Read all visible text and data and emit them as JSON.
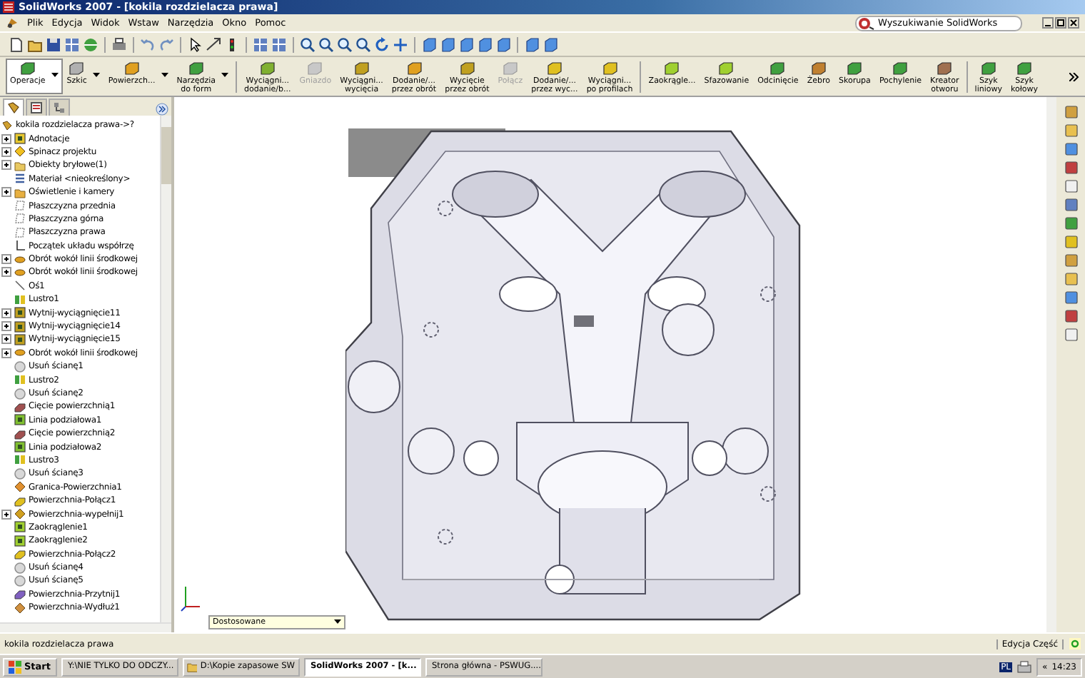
{
  "window": {
    "title": "SolidWorks 2007 - [kokila rozdzielacza prawa]"
  },
  "menu": [
    "Plik",
    "Edycja",
    "Widok",
    "Wstaw",
    "Narzędzia",
    "Okno",
    "Pomoc"
  ],
  "search": {
    "placeholder": "Wyszukiwanie SolidWorks"
  },
  "feature_toolbar": [
    {
      "label": "Operacje",
      "selected": true,
      "disabled": false,
      "dropdown": true
    },
    {
      "label": "Szkic",
      "selected": false,
      "disabled": false,
      "dropdown": true
    },
    {
      "label": "Powierzch...",
      "selected": false,
      "disabled": false,
      "dropdown": true
    },
    {
      "label": "Narzędzia\ndo form",
      "selected": false,
      "disabled": false,
      "dropdown": true
    },
    {
      "label": "Wyciągni...\ndodanie/b...",
      "selected": false,
      "disabled": false,
      "dropdown": false
    },
    {
      "label": "Gniazdo",
      "selected": false,
      "disabled": true,
      "dropdown": false
    },
    {
      "label": "Wyciągni...\nwycięcia",
      "selected": false,
      "disabled": false,
      "dropdown": false
    },
    {
      "label": "Dodanie/...\nprzez obrót",
      "selected": false,
      "disabled": false,
      "dropdown": false
    },
    {
      "label": "Wycięcie\nprzez obrót",
      "selected": false,
      "disabled": false,
      "dropdown": false
    },
    {
      "label": "Połącz",
      "selected": false,
      "disabled": true,
      "dropdown": false
    },
    {
      "label": "Dodanie/...\nprzez wyc...",
      "selected": false,
      "disabled": false,
      "dropdown": false
    },
    {
      "label": "Wyciągni...\npo profilach",
      "selected": false,
      "disabled": false,
      "dropdown": false
    },
    {
      "label": "Zaokrągle...",
      "selected": false,
      "disabled": false,
      "dropdown": false
    },
    {
      "label": "Sfazowanie",
      "selected": false,
      "disabled": false,
      "dropdown": false
    },
    {
      "label": "Odcinięcie",
      "selected": false,
      "disabled": false,
      "dropdown": false
    },
    {
      "label": "Żebro",
      "selected": false,
      "disabled": false,
      "dropdown": false
    },
    {
      "label": "Skorupa",
      "selected": false,
      "disabled": false,
      "dropdown": false
    },
    {
      "label": "Pochylenie",
      "selected": false,
      "disabled": false,
      "dropdown": false
    },
    {
      "label": "Kreator\notworu",
      "selected": false,
      "disabled": false,
      "dropdown": false
    },
    {
      "label": "Szyk\nliniowy",
      "selected": false,
      "disabled": false,
      "dropdown": false
    },
    {
      "label": "Szyk\nkołowy",
      "selected": false,
      "disabled": false,
      "dropdown": false
    }
  ],
  "feature_tree": {
    "tabs": [
      {
        "selected": true
      },
      {
        "selected": false
      },
      {
        "selected": false
      }
    ],
    "root": "kokila rozdzielacza prawa->?",
    "items": [
      {
        "label": "Adnotacje",
        "kind": "annotation",
        "expandable": true
      },
      {
        "label": "Spinacz projektu",
        "kind": "binder",
        "expandable": true
      },
      {
        "label": "Obiekty bryłowe(1)",
        "kind": "folder",
        "expandable": true
      },
      {
        "label": "Materiał <nieokreślony>",
        "kind": "material",
        "expandable": false
      },
      {
        "label": "Oświetlenie i kamery",
        "kind": "lights",
        "expandable": true
      },
      {
        "label": "Płaszczyzna przednia",
        "kind": "plane",
        "expandable": false
      },
      {
        "label": "Płaszczyzna górna",
        "kind": "plane",
        "expandable": false
      },
      {
        "label": "Płaszczyzna prawa",
        "kind": "plane",
        "expandable": false
      },
      {
        "label": "Początek układu współrzę",
        "kind": "origin",
        "expandable": false
      },
      {
        "label": "Obrót wokół linii środkowej",
        "kind": "revolve",
        "expandable": true
      },
      {
        "label": "Obrót wokół linii środkowej",
        "kind": "revolve",
        "expandable": true
      },
      {
        "label": "Oś1",
        "kind": "axis",
        "expandable": false
      },
      {
        "label": "Lustro1",
        "kind": "mirror",
        "expandable": false
      },
      {
        "label": "Wytnij-wyciągnięcie11",
        "kind": "cut",
        "expandable": true
      },
      {
        "label": "Wytnij-wyciągnięcie14",
        "kind": "cut",
        "expandable": true
      },
      {
        "label": "Wytnij-wyciągnięcie15",
        "kind": "cut",
        "expandable": true
      },
      {
        "label": "Obrót wokół linii środkowej",
        "kind": "revolve",
        "expandable": true
      },
      {
        "label": "Usuń ścianę1",
        "kind": "deleteface",
        "expandable": false
      },
      {
        "label": "Lustro2",
        "kind": "mirror",
        "expandable": false
      },
      {
        "label": "Usuń ścianę2",
        "kind": "deleteface",
        "expandable": false
      },
      {
        "label": "Cięcie powierzchnią1",
        "kind": "surfacecut",
        "expandable": false
      },
      {
        "label": "Linia podziałowa1",
        "kind": "splitline",
        "expandable": false
      },
      {
        "label": "Cięcie powierzchnią2",
        "kind": "surfacecut",
        "expandable": false
      },
      {
        "label": "Linia podziałowa2",
        "kind": "splitline",
        "expandable": false
      },
      {
        "label": "Lustro3",
        "kind": "mirror",
        "expandable": false
      },
      {
        "label": "Usuń ścianę3",
        "kind": "deleteface",
        "expandable": false
      },
      {
        "label": "Granica-Powierzchnia1",
        "kind": "boundary",
        "expandable": false
      },
      {
        "label": "Powierzchnia-Połącz1",
        "kind": "knit",
        "expandable": false
      },
      {
        "label": "Powierzchnia-wypełnij1",
        "kind": "fill",
        "expandable": true
      },
      {
        "label": "Zaokrąglenie1",
        "kind": "fillet",
        "expandable": false
      },
      {
        "label": "Zaokrąglenie2",
        "kind": "fillet",
        "expandable": false
      },
      {
        "label": "Powierzchnia-Połącz2",
        "kind": "knit",
        "expandable": false
      },
      {
        "label": "Usuń ścianę4",
        "kind": "deleteface",
        "expandable": false
      },
      {
        "label": "Usuń ścianę5",
        "kind": "deleteface",
        "expandable": false
      },
      {
        "label": "Powierzchnia-Przytnij1",
        "kind": "trim",
        "expandable": false
      },
      {
        "label": "Powierzchnia-Wydłuż1",
        "kind": "extend",
        "expandable": false
      }
    ]
  },
  "viewport": {
    "view_orientation": "Dostosowane"
  },
  "status_bar": {
    "document": "kokila rozdzielacza prawa",
    "mode": "Edycja Część"
  },
  "taskbar": {
    "start": "Start",
    "tasks": [
      {
        "label": "Y:\\NIE TYLKO DO ODCZY...",
        "kind": "folder",
        "selected": false
      },
      {
        "label": "D:\\Kopie zapasowe SW",
        "kind": "folder",
        "selected": false
      },
      {
        "label": "SolidWorks 2007 - [k...",
        "kind": "app",
        "selected": true
      },
      {
        "label": "Strona główna - PSWUG....",
        "kind": "browser",
        "selected": false
      }
    ],
    "language": "PL",
    "tray_toggle": "«",
    "clock": "14:23"
  }
}
